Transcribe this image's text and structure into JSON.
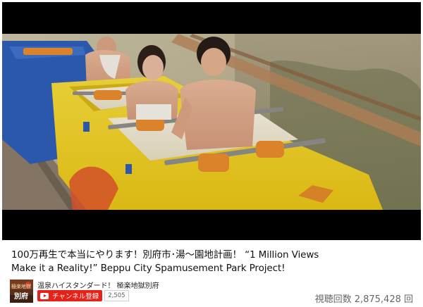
{
  "video": {
    "title_line1": "100万再生で本当にやります！別府市･湯～園地計画！ “1 Million Views",
    "title_line2": "Make it a Reality!” Beppu City Spamusement Park Project!",
    "views_label": "視聴回数 2,875,428 回"
  },
  "channel": {
    "name": "温泉ハイスタンダード！ 極楽地獄別府",
    "avatar_text_top": "極楽地獄",
    "avatar_text_bottom": "別府",
    "subscribe_label": "チャンネル登録",
    "subscriber_count": "2,505"
  },
  "colors": {
    "subscribe_red": "#e62117",
    "coaster_yellow": "#f2d21c",
    "coaster_blue": "#2a5cb8"
  }
}
